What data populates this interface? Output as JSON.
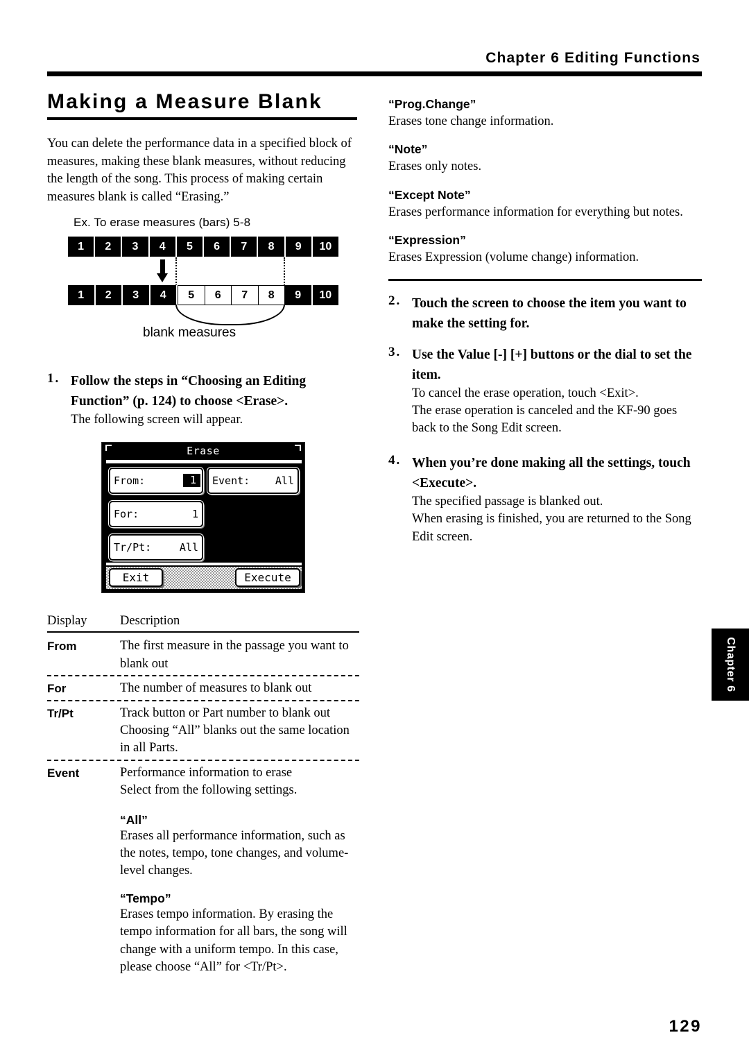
{
  "running_head": "Chapter 6 Editing Functions",
  "section_title": "Making a Measure Blank",
  "intro_paragraph": "You can delete the performance data in a specified block of measures, making these blank measures, without reducing the length of the song. This process of making certain measures blank is called “Erasing.”",
  "example": {
    "caption": "Ex. To erase measures (bars) 5-8",
    "row1": [
      "1",
      "2",
      "3",
      "4",
      "5",
      "6",
      "7",
      "8",
      "9",
      "10"
    ],
    "row2": [
      "1",
      "2",
      "3",
      "4",
      "5",
      "6",
      "7",
      "8",
      "9",
      "10"
    ],
    "blank_indices": [
      4,
      5,
      6,
      7
    ],
    "brace_label": "blank measures"
  },
  "steps": [
    {
      "number": "1.",
      "heading": "Follow the steps in “Choosing an Editing Function” (p. 124) to choose <Erase>.",
      "body": [
        "The following screen will appear."
      ]
    },
    {
      "number": "2.",
      "heading": "Touch the screen to choose the item you want to make the setting for.",
      "body": []
    },
    {
      "number": "3.",
      "heading": "Use the Value [-] [+] buttons or the dial to set the item.",
      "body": [
        "To cancel the erase operation, touch <Exit>.",
        "The erase operation is canceled and the KF-90 goes back to the Song Edit screen."
      ]
    },
    {
      "number": "4.",
      "heading": "When you’re done making all the settings, touch <Execute>.",
      "body": [
        "The specified passage is blanked out.",
        "When erasing is finished, you are returned to the Song Edit screen."
      ]
    }
  ],
  "lcd": {
    "title": "Erase",
    "fields": [
      {
        "label": "From:",
        "value": "1",
        "highlighted": true
      },
      {
        "label": "Event:",
        "value": "All",
        "highlighted": false
      },
      {
        "label": "For:",
        "value": "1",
        "highlighted": false
      },
      {
        "label": "Tr/Pt:",
        "value": "All",
        "highlighted": false
      }
    ],
    "buttons": {
      "exit": "Exit",
      "execute": "Execute"
    }
  },
  "table": {
    "headers": {
      "display": "Display",
      "description": "Description"
    },
    "rows": [
      {
        "display": "From",
        "description": [
          "The first measure in the passage you want to blank out"
        ]
      },
      {
        "display": "For",
        "description": [
          "The number of measures to blank out"
        ]
      },
      {
        "display": "Tr/Pt",
        "description": [
          "Track button or Part number to blank out",
          "Choosing “All” blanks out the same location in all Parts."
        ]
      },
      {
        "display": "Event",
        "description": [
          "Performance information to erase",
          "Select from the following settings."
        ]
      }
    ]
  },
  "event_settings": [
    {
      "term": "“All”",
      "definition": "Erases all performance information, such as the notes, tempo, tone changes, and volume-level changes."
    },
    {
      "term": "“Tempo”",
      "definition": "Erases tempo information. By erasing the tempo information for all bars, the song will change with a uniform tempo. In this case, please choose “All” for <Tr/Pt>."
    },
    {
      "term": "“Prog.Change”",
      "definition": "Erases tone change information."
    },
    {
      "term": "“Note”",
      "definition": "Erases only notes."
    },
    {
      "term": "“Except Note”",
      "definition": "Erases performance information for everything but notes."
    },
    {
      "term": "“Expression”",
      "definition": "Erases Expression (volume change) information."
    }
  ],
  "chapter_tab": "Chapter 6",
  "page_number": "129"
}
